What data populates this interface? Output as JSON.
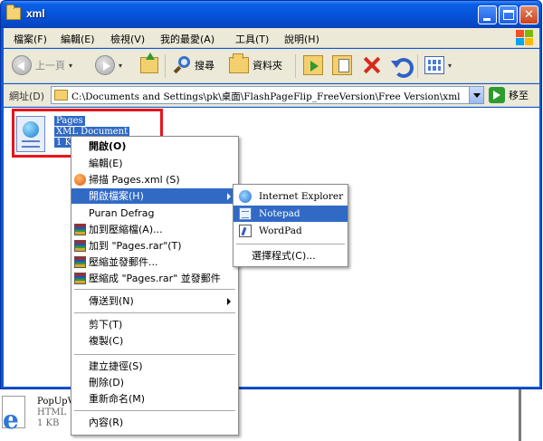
{
  "window": {
    "title": "xml",
    "controls": {
      "minimize": "minimize",
      "maximize": "maximize",
      "close": "close"
    }
  },
  "menubar": {
    "items": [
      "檔案(F)",
      "編輯(E)",
      "檢視(V)",
      "我的最愛(A)",
      "工具(T)",
      "說明(H)"
    ]
  },
  "toolbar": {
    "back_label": "上一頁",
    "search_label": "搜尋",
    "folders_label": "資料夾"
  },
  "addressbar": {
    "label": "網址(D)",
    "path": "C:\\Documents and Settings\\pk\\桌面\\FlashPageFlip_FreeVersion\\Free Version\\xml",
    "go_label": "移至"
  },
  "selected_file": {
    "name": "Pages",
    "type": "XML Document",
    "size": "1 K"
  },
  "other_file": {
    "name": "PopUpV",
    "type": "HTML",
    "size": "1 KB"
  },
  "context_menu": {
    "items": [
      {
        "label": "開啟(O)",
        "bold": true,
        "icon": ""
      },
      {
        "label": "編輯(E)",
        "icon": ""
      },
      {
        "label": "掃描 Pages.xml (S)",
        "icon": "scan-icon"
      },
      {
        "label": "開啟檔案(H)",
        "icon": "",
        "submenu": true,
        "highlight": true
      },
      {
        "label": "Puran Defrag",
        "icon": ""
      },
      {
        "label": "加到壓縮檔(A)...",
        "icon": "rar-icon"
      },
      {
        "label": "加到 \"Pages.rar\"(T)",
        "icon": "rar-icon"
      },
      {
        "label": "壓縮並發郵件...",
        "icon": "rar-icon"
      },
      {
        "label": "壓縮成 \"Pages.rar\" 並發郵件",
        "icon": "rar-icon"
      },
      {
        "label": "傳送到(N)",
        "icon": "",
        "submenu": true
      },
      {
        "label": "剪下(T)",
        "icon": ""
      },
      {
        "label": "複製(C)",
        "icon": ""
      },
      {
        "label": "建立捷徑(S)",
        "icon": ""
      },
      {
        "label": "刪除(D)",
        "icon": ""
      },
      {
        "label": "重新命名(M)",
        "icon": ""
      },
      {
        "label": "內容(R)",
        "icon": ""
      }
    ]
  },
  "open_with_submenu": {
    "items": [
      {
        "label": "Internet Explorer",
        "icon": "internet-explorer-icon"
      },
      {
        "label": "Notepad",
        "icon": "notepad-icon",
        "highlight": true
      },
      {
        "label": "WordPad",
        "icon": "wordpad-icon"
      }
    ],
    "choose_program": "選擇程式(C)..."
  },
  "colors": {
    "titlebar_blue": "#0653db",
    "selection_blue": "#316ac5",
    "annotation_red": "#e8141b",
    "chrome": "#ece9d8"
  }
}
